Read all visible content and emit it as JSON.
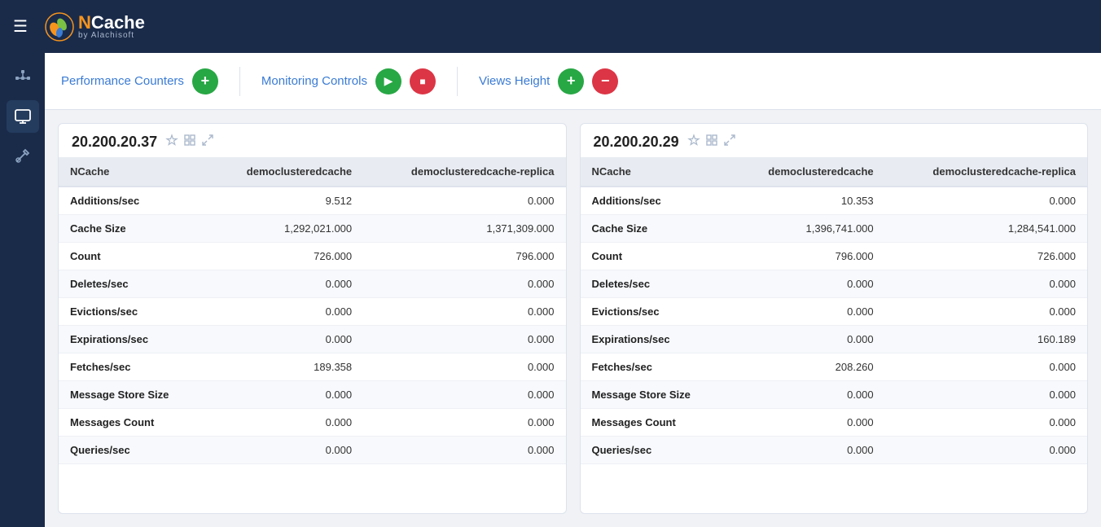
{
  "navbar": {
    "menu_label": "☰",
    "logo_n": "N",
    "logo_cache": "Cache",
    "logo_by": "by Alachisoft"
  },
  "sidebar": {
    "items": [
      {
        "icon": "⊞",
        "name": "dashboard",
        "active": false
      },
      {
        "icon": "🖥",
        "name": "monitor",
        "active": true
      },
      {
        "icon": "🔧",
        "name": "tools",
        "active": false
      }
    ]
  },
  "toolbar": {
    "performance_counters_label": "Performance Counters",
    "monitoring_controls_label": "Monitoring Controls",
    "views_height_label": "Views Height",
    "add_label": "+",
    "remove_label": "−",
    "play_label": "▶",
    "stop_label": "■"
  },
  "cards": [
    {
      "id": "card1",
      "title": "20.200.20.37",
      "columns": [
        "NCache",
        "democlusteredcache",
        "democlusteredcache-replica"
      ],
      "rows": [
        {
          "metric": "Additions/sec",
          "col1": "9.512",
          "col2": "0.000",
          "col1_blue": false,
          "col2_blue": true
        },
        {
          "metric": "Cache Size",
          "col1": "1,292,021.000",
          "col2": "1,371,309.000",
          "col1_blue": true,
          "col2_blue": true
        },
        {
          "metric": "Count",
          "col1": "726.000",
          "col2": "796.000",
          "col1_blue": false,
          "col2_blue": false
        },
        {
          "metric": "Deletes/sec",
          "col1": "0.000",
          "col2": "0.000",
          "col1_blue": true,
          "col2_blue": true
        },
        {
          "metric": "Evictions/sec",
          "col1": "0.000",
          "col2": "0.000",
          "col1_blue": false,
          "col2_blue": false
        },
        {
          "metric": "Expirations/sec",
          "col1": "0.000",
          "col2": "0.000",
          "col1_blue": false,
          "col2_blue": false
        },
        {
          "metric": "Fetches/sec",
          "col1": "189.358",
          "col2": "0.000",
          "col1_blue": false,
          "col2_blue": false
        },
        {
          "metric": "Message Store Size",
          "col1": "0.000",
          "col2": "0.000",
          "col1_blue": true,
          "col2_blue": true
        },
        {
          "metric": "Messages Count",
          "col1": "0.000",
          "col2": "0.000",
          "col1_blue": false,
          "col2_blue": false
        },
        {
          "metric": "Queries/sec",
          "col1": "0.000",
          "col2": "0.000",
          "col1_blue": true,
          "col2_blue": true
        }
      ]
    },
    {
      "id": "card2",
      "title": "20.200.20.29",
      "columns": [
        "NCache",
        "democlusteredcache",
        "democlusteredcache-replica"
      ],
      "rows": [
        {
          "metric": "Additions/sec",
          "col1": "10.353",
          "col2": "0.000",
          "col1_blue": false,
          "col2_blue": true
        },
        {
          "metric": "Cache Size",
          "col1": "1,396,741.000",
          "col2": "1,284,541.000",
          "col1_blue": true,
          "col2_blue": true
        },
        {
          "metric": "Count",
          "col1": "796.000",
          "col2": "726.000",
          "col1_blue": false,
          "col2_blue": false
        },
        {
          "metric": "Deletes/sec",
          "col1": "0.000",
          "col2": "0.000",
          "col1_blue": true,
          "col2_blue": true
        },
        {
          "metric": "Evictions/sec",
          "col1": "0.000",
          "col2": "0.000",
          "col1_blue": false,
          "col2_blue": false
        },
        {
          "metric": "Expirations/sec",
          "col1": "0.000",
          "col2": "160.189",
          "col1_blue": false,
          "col2_blue": false
        },
        {
          "metric": "Fetches/sec",
          "col1": "208.260",
          "col2": "0.000",
          "col1_blue": false,
          "col2_blue": false
        },
        {
          "metric": "Message Store Size",
          "col1": "0.000",
          "col2": "0.000",
          "col1_blue": true,
          "col2_blue": true
        },
        {
          "metric": "Messages Count",
          "col1": "0.000",
          "col2": "0.000",
          "col1_blue": false,
          "col2_blue": false
        },
        {
          "metric": "Queries/sec",
          "col1": "0.000",
          "col2": "0.000",
          "col1_blue": true,
          "col2_blue": true
        }
      ]
    }
  ]
}
